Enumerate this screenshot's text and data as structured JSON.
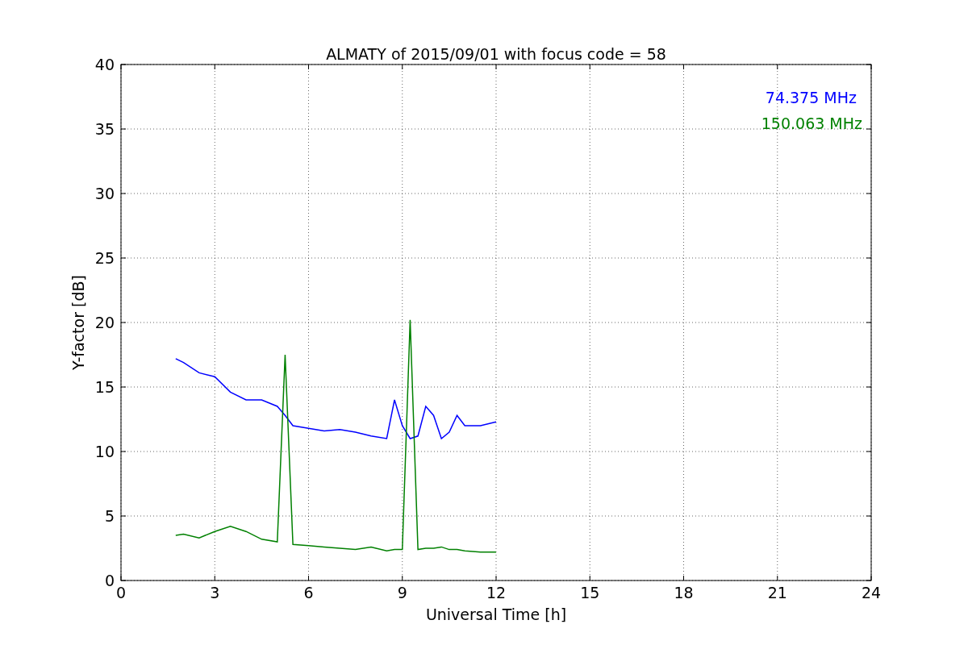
{
  "chart_data": {
    "type": "line",
    "title": "ALMATY of 2015/09/01 with focus code = 58",
    "xlabel": "Universal Time [h]",
    "ylabel": "Y-factor [dB]",
    "x": [
      1.75,
      2,
      2.5,
      3,
      3.5,
      4,
      4.5,
      5,
      5.25,
      5.5,
      6,
      6.5,
      7,
      7.5,
      8,
      8.5,
      8.75,
      9,
      9.25,
      9.5,
      9.75,
      10,
      10.25,
      10.5,
      10.75,
      11,
      11.5,
      12
    ],
    "series": [
      {
        "name": "74.375 MHz",
        "color": "#0000ff",
        "values": [
          17.2,
          16.9,
          16.1,
          15.8,
          14.6,
          14.0,
          14.0,
          13.5,
          12.8,
          12.0,
          11.8,
          11.6,
          11.7,
          11.5,
          11.2,
          11.0,
          14.0,
          12.0,
          11.0,
          11.2,
          13.5,
          12.8,
          11.0,
          11.5,
          12.8,
          12.0,
          12.0,
          12.3
        ]
      },
      {
        "name": "150.063 MHz",
        "color": "#008000",
        "values": [
          3.5,
          3.6,
          3.3,
          3.8,
          4.2,
          3.8,
          3.2,
          3.0,
          17.5,
          2.8,
          2.7,
          2.6,
          2.5,
          2.4,
          2.6,
          2.3,
          2.4,
          2.4,
          20.2,
          2.4,
          2.5,
          2.5,
          2.6,
          2.4,
          2.4,
          2.3,
          2.2,
          2.2
        ]
      }
    ],
    "xlim": [
      0,
      24
    ],
    "ylim": [
      0,
      40
    ],
    "xticks": [
      0,
      3,
      6,
      9,
      12,
      15,
      18,
      21,
      24
    ],
    "yticks": [
      0,
      5,
      10,
      15,
      20,
      25,
      30,
      35,
      40
    ],
    "grid": true
  }
}
